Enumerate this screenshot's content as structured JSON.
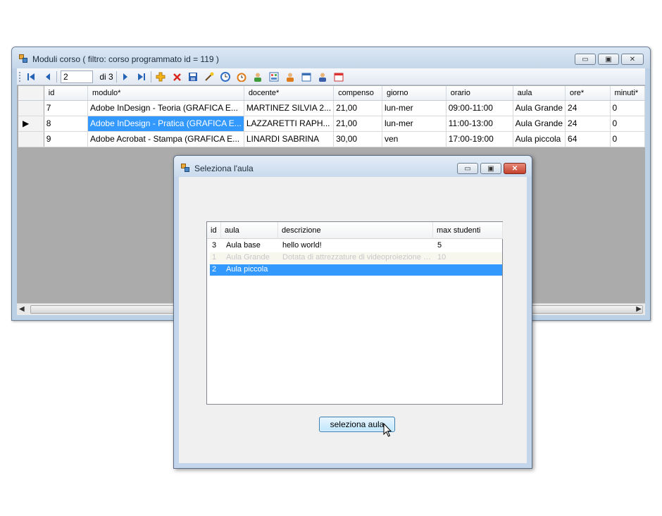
{
  "main_window": {
    "title": "Moduli corso ( filtro: corso programmato id = 119 )",
    "caption": {
      "minimize": "▭",
      "maximize": "▣",
      "close": "✕"
    },
    "navigator": {
      "position_value": "2",
      "of_label": "di 3"
    },
    "grid": {
      "columns": [
        "id",
        "modulo*",
        "docente*",
        "compenso",
        "giorno",
        "orario",
        "aula",
        "ore*",
        "minuti*"
      ],
      "rows": [
        {
          "id": "7",
          "modulo": "Adobe InDesign - Teoria (GRAFICA E...",
          "docente": "MARTINEZ SILVIA 2...",
          "compenso": "21,00",
          "giorno": "lun-mer",
          "orario": "09:00-11:00",
          "aula": "Aula Grande",
          "ore": "24",
          "minuti": "0",
          "current": false
        },
        {
          "id": "8",
          "modulo": "Adobe InDesign - Pratica (GRAFICA E...",
          "docente": "LAZZARETTI RAPH...",
          "compenso": "21,00",
          "giorno": "lun-mer",
          "orario": "11:00-13:00",
          "aula": "Aula Grande",
          "ore": "24",
          "minuti": "0",
          "current": true
        },
        {
          "id": "9",
          "modulo": "Adobe Acrobat - Stampa (GRAFICA E...",
          "docente": "LINARDI SABRINA",
          "compenso": "30,00",
          "giorno": "ven",
          "orario": "17:00-19:00",
          "aula": "Aula piccola",
          "ore": "64",
          "minuti": "0",
          "current": false
        }
      ],
      "current_row_marker": "▶"
    },
    "scroll": {
      "left_arrow": "◀",
      "right_arrow": "▶"
    }
  },
  "dialog": {
    "title": "Seleziona l'aula",
    "caption": {
      "minimize": "▭",
      "maximize": "▣",
      "close": "✕"
    },
    "list": {
      "columns": [
        "id",
        "aula",
        "descrizione",
        "max studenti"
      ],
      "rows": [
        {
          "id": "3",
          "aula": "Aula base",
          "descrizione": "hello world!",
          "max": "5",
          "state": "normal"
        },
        {
          "id": "1",
          "aula": "Aula Grande",
          "descrizione": "Dotata di attrezzature di videoproiezione e...",
          "max": "10",
          "state": "disabled"
        },
        {
          "id": "2",
          "aula": "Aula piccola",
          "descrizione": "",
          "max": "",
          "state": "selected"
        }
      ]
    },
    "select_button_label": "seleziona aula"
  },
  "colors": {
    "selection": "#3399ff",
    "disabled_text": "#c8c8c8"
  },
  "icons": [
    "move-first-icon",
    "move-previous-icon",
    "move-next-icon",
    "move-last-icon",
    "add-icon",
    "delete-icon",
    "save-icon",
    "wand-icon",
    "clock-icon",
    "alarm-icon",
    "user-icon",
    "grid-icon",
    "user2-icon",
    "calendar-icon",
    "user3-icon",
    "calendar2-icon"
  ]
}
